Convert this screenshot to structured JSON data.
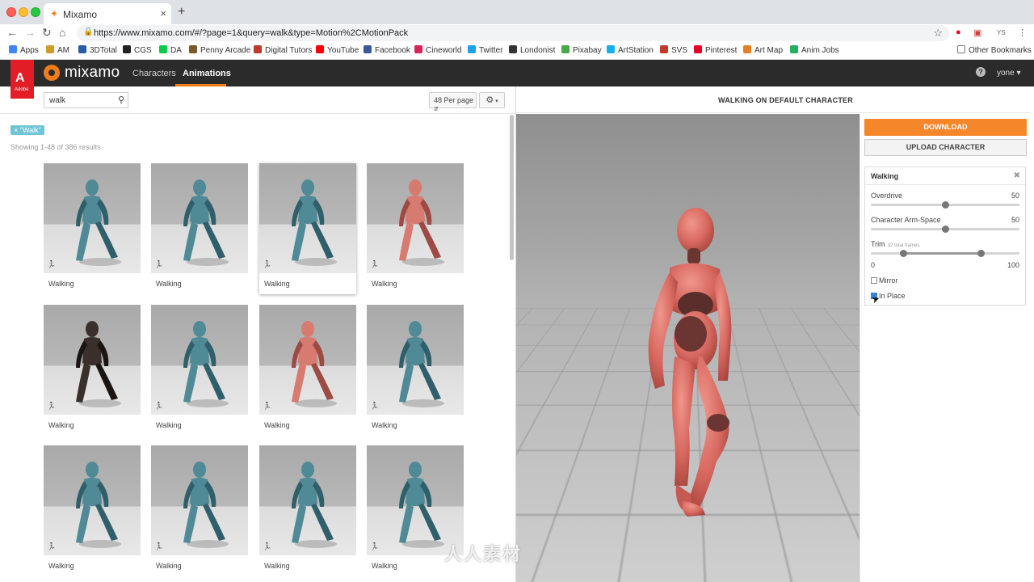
{
  "browser": {
    "tab_title": "Mixamo",
    "url": "https://www.mixamo.com/#/?page=1&query=walk&type=Motion%2CMotionPack",
    "bookmarks": [
      {
        "label": "Apps",
        "icon": "apps-grid-icon",
        "color": "#4285f4"
      },
      {
        "label": "AM",
        "icon": "am-icon",
        "color": "#d19a2a"
      },
      {
        "label": "3DTotal",
        "icon": "3dtotal-icon",
        "color": "#2a5aa8"
      },
      {
        "label": "CGS",
        "icon": "cgs-icon",
        "color": "#222222"
      },
      {
        "label": "DA",
        "icon": "deviantart-icon",
        "color": "#05cc47"
      },
      {
        "label": "Penny Arcade",
        "icon": "penny-arcade-icon",
        "color": "#7a5a2a"
      },
      {
        "label": "Digital Tutors",
        "icon": "digital-tutors-icon",
        "color": "#c0392b"
      },
      {
        "label": "YouTube",
        "icon": "youtube-icon",
        "color": "#ff0000"
      },
      {
        "label": "Facebook",
        "icon": "facebook-icon",
        "color": "#3b5998"
      },
      {
        "label": "Cineworld",
        "icon": "cineworld-icon",
        "color": "#d9245a"
      },
      {
        "label": "Twitter",
        "icon": "twitter-icon",
        "color": "#1da1f2"
      },
      {
        "label": "Londonist",
        "icon": "londonist-icon",
        "color": "#333333"
      },
      {
        "label": "Pixabay",
        "icon": "pixabay-icon",
        "color": "#48a947"
      },
      {
        "label": "ArtStation",
        "icon": "artstation-icon",
        "color": "#13aff0"
      },
      {
        "label": "SVS",
        "icon": "svs-icon",
        "color": "#c0392b"
      },
      {
        "label": "Pinterest",
        "icon": "pinterest-icon",
        "color": "#e60023"
      },
      {
        "label": "Art Map",
        "icon": "map-pin-icon",
        "color": "#e67e22"
      },
      {
        "label": "Anim Jobs",
        "icon": "anim-jobs-icon",
        "color": "#27ae60"
      }
    ],
    "other_bookmarks": "Other Bookmarks",
    "profile_initials": "YS"
  },
  "app": {
    "brand": "mixamo",
    "adobe_label": "Adobe",
    "nav": [
      {
        "label": "Characters"
      },
      {
        "label": "Animations"
      }
    ],
    "active_nav": "Animations",
    "user": "yone",
    "accent": "#f07d1a"
  },
  "search": {
    "value": "walk",
    "placeholder": "Search"
  },
  "per_page": "48 Per page",
  "filter_chip": "× \"Walk\"",
  "results_text": "Showing 1-48 of 386 results",
  "cards": [
    {
      "label": "Walking",
      "character": "teal-mannequin"
    },
    {
      "label": "Walking",
      "character": "teal-mannequin"
    },
    {
      "label": "Walking",
      "character": "teal-mannequin"
    },
    {
      "label": "Walking",
      "character": "pink-mannequin"
    },
    {
      "label": "Walking",
      "character": "zombie"
    },
    {
      "label": "Walking",
      "character": "teal-mannequin"
    },
    {
      "label": "Walking",
      "character": "pink-mannequin"
    },
    {
      "label": "Walking",
      "character": "teal-mannequin"
    },
    {
      "label": "Walking",
      "character": "teal-mannequin"
    },
    {
      "label": "Walking",
      "character": "teal-mannequin"
    },
    {
      "label": "Walking",
      "character": "teal-mannequin"
    },
    {
      "label": "Walking",
      "character": "teal-mannequin"
    }
  ],
  "viewer": {
    "title": "WALKING ON DEFAULT CHARACTER",
    "download": "DOWNLOAD",
    "upload": "UPLOAD CHARACTER",
    "download_color": "#f5862a"
  },
  "settings": {
    "title": "Walking",
    "overdrive": {
      "label": "Overdrive",
      "value": 50
    },
    "arm_space": {
      "label": "Character Arm-Space",
      "value": 50
    },
    "trim": {
      "label": "Trim",
      "sub": "32 total frames",
      "min_label": "0",
      "max_label": "100",
      "start": 22,
      "end": 74
    },
    "mirror": {
      "label": "Mirror",
      "checked": false
    },
    "in_place": {
      "label": "In Place",
      "checked": true
    }
  },
  "watermark": "人人素材"
}
